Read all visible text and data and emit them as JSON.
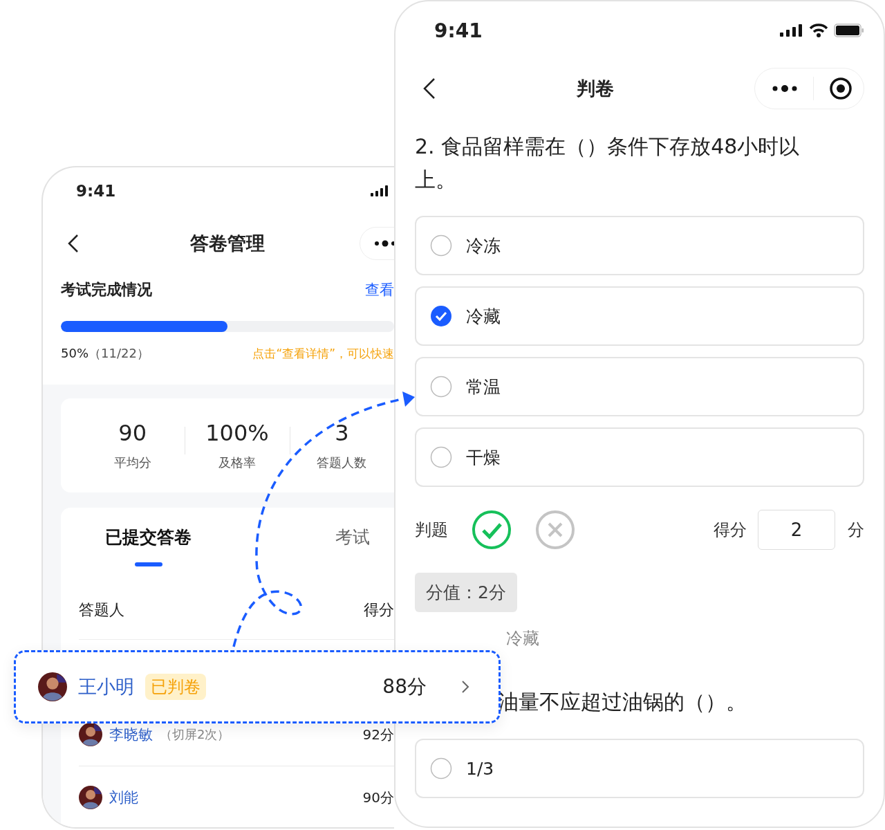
{
  "left_phone": {
    "status_time": "9:41",
    "nav_title": "答卷管理",
    "section_title": "考试完成情况",
    "section_link": "查看",
    "progress": {
      "level": 0.5,
      "percent": "50%",
      "count": "（11/22）",
      "hint": "点击“查看详情”，可以快速"
    },
    "stats": [
      {
        "value": "90",
        "label": "平均分"
      },
      {
        "value": "100%",
        "label": "及格率"
      },
      {
        "value": "3",
        "label": "答题人数"
      }
    ],
    "tabs": [
      {
        "label": "已提交答卷",
        "selected": true
      },
      {
        "label": "考试",
        "selected": false
      }
    ],
    "columns": [
      "答题人",
      "得分"
    ],
    "rows": [
      {
        "name": "李晓敏",
        "note": "（切屏2次）",
        "score": "92分"
      },
      {
        "name": "刘能",
        "score": "90分"
      }
    ]
  },
  "highlight_row": {
    "name": "王小明",
    "badge": "已判卷",
    "score": "88分"
  },
  "right_phone": {
    "status_time": "9:41",
    "nav_title": "判卷",
    "question": "2. 食品留样需在（）条件下存放48小时以上。",
    "options": [
      {
        "label": "冷冻",
        "selected": false
      },
      {
        "label": "冷藏",
        "selected": true
      },
      {
        "label": "常温",
        "selected": false
      },
      {
        "label": "干燥",
        "selected": false
      }
    ],
    "judge_label": "判题",
    "judge_options": [
      {
        "kind": "correct",
        "selected": true
      },
      {
        "kind": "wrong",
        "selected": false
      }
    ],
    "score_label": "得分",
    "score_value": "2",
    "score_unit": "分",
    "points_tag": "分值：2分",
    "answer_value": "冷藏",
    "next_question": "油量不应超过油锅的（）。",
    "next_options": [
      {
        "label": "1/3",
        "selected": false
      }
    ]
  }
}
